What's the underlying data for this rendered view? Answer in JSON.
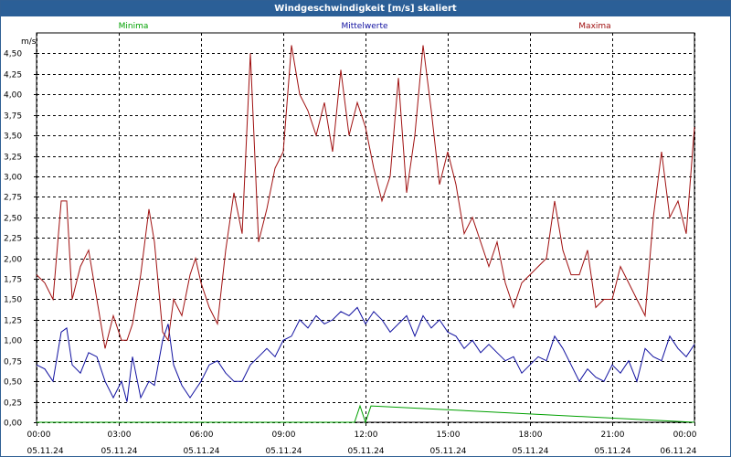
{
  "window": {
    "title": "Windgeschwindigkeit [m/s] skaliert"
  },
  "chart_data": {
    "type": "line",
    "unit_label": "m/s",
    "ylim": [
      0,
      4.75
    ],
    "yticks": [
      0,
      0.25,
      0.5,
      0.75,
      1.0,
      1.25,
      1.5,
      1.75,
      2.0,
      2.25,
      2.5,
      2.75,
      3.0,
      3.25,
      3.5,
      3.75,
      4.0,
      4.25,
      4.5
    ],
    "ytick_labels": [
      "0,00",
      "0,25",
      "0,50",
      "0,75",
      "1,00",
      "1,25",
      "1,50",
      "1,75",
      "2,00",
      "2,25",
      "2,50",
      "2,75",
      "3,00",
      "3,25",
      "3,50",
      "3,75",
      "4,00",
      "4,25",
      "4,50"
    ],
    "xlim": [
      0,
      24
    ],
    "xticks": [
      0,
      3,
      6,
      9,
      12,
      15,
      18,
      21,
      24
    ],
    "xtick_times": [
      "00:00",
      "03:00",
      "06:00",
      "09:00",
      "12:00",
      "15:00",
      "18:00",
      "21:00",
      "00:00"
    ],
    "xtick_dates": [
      "05.11.24",
      "05.11.24",
      "05.11.24",
      "05.11.24",
      "05.11.24",
      "05.11.24",
      "05.11.24",
      "05.11.24",
      "06.11.24"
    ],
    "grid": true,
    "series": [
      {
        "name": "Minima",
        "color": "#00a000",
        "x": [
          0,
          11.6,
          11.8,
          12.0,
          12.2,
          24
        ],
        "y": [
          0,
          0,
          0.2,
          0,
          0.2,
          0
        ]
      },
      {
        "name": "Mittelwerte",
        "color": "#1010a0",
        "x": [
          0,
          0.3,
          0.6,
          0.9,
          1.1,
          1.3,
          1.6,
          1.9,
          2.2,
          2.5,
          2.8,
          3.1,
          3.3,
          3.5,
          3.8,
          4.1,
          4.3,
          4.6,
          4.8,
          5.0,
          5.3,
          5.6,
          5.8,
          6.0,
          6.3,
          6.6,
          6.9,
          7.2,
          7.5,
          7.8,
          8.1,
          8.4,
          8.7,
          9.0,
          9.3,
          9.6,
          9.9,
          10.2,
          10.5,
          10.8,
          11.1,
          11.4,
          11.7,
          12.0,
          12.3,
          12.6,
          12.9,
          13.2,
          13.5,
          13.8,
          14.1,
          14.4,
          14.7,
          15.0,
          15.3,
          15.6,
          15.9,
          16.2,
          16.5,
          16.8,
          17.1,
          17.4,
          17.7,
          18.0,
          18.3,
          18.6,
          18.9,
          19.2,
          19.5,
          19.8,
          20.1,
          20.4,
          20.7,
          21.0,
          21.3,
          21.6,
          21.9,
          22.2,
          22.5,
          22.8,
          23.1,
          23.4,
          23.7,
          24.0
        ],
        "y": [
          0.7,
          0.65,
          0.5,
          1.1,
          1.15,
          0.7,
          0.6,
          0.85,
          0.8,
          0.5,
          0.3,
          0.5,
          0.25,
          0.8,
          0.3,
          0.5,
          0.45,
          1.0,
          1.2,
          0.7,
          0.45,
          0.3,
          0.4,
          0.5,
          0.7,
          0.75,
          0.6,
          0.5,
          0.5,
          0.7,
          0.8,
          0.9,
          0.8,
          1.0,
          1.05,
          1.25,
          1.15,
          1.3,
          1.2,
          1.25,
          1.35,
          1.3,
          1.4,
          1.2,
          1.35,
          1.25,
          1.1,
          1.2,
          1.3,
          1.05,
          1.3,
          1.15,
          1.25,
          1.1,
          1.05,
          0.9,
          1.0,
          0.85,
          0.95,
          0.85,
          0.75,
          0.8,
          0.6,
          0.7,
          0.8,
          0.75,
          1.05,
          0.9,
          0.7,
          0.5,
          0.65,
          0.55,
          0.5,
          0.7,
          0.6,
          0.75,
          0.5,
          0.9,
          0.8,
          0.75,
          1.05,
          0.9,
          0.8,
          0.95
        ]
      },
      {
        "name": "Maxima",
        "color": "#a01010",
        "x": [
          0,
          0.3,
          0.6,
          0.9,
          1.1,
          1.3,
          1.6,
          1.9,
          2.2,
          2.5,
          2.8,
          3.1,
          3.3,
          3.5,
          3.8,
          4.1,
          4.3,
          4.6,
          4.8,
          5.0,
          5.3,
          5.6,
          5.8,
          6.0,
          6.3,
          6.6,
          6.9,
          7.2,
          7.5,
          7.8,
          8.1,
          8.4,
          8.7,
          9.0,
          9.3,
          9.6,
          9.9,
          10.2,
          10.5,
          10.8,
          11.1,
          11.4,
          11.7,
          12.0,
          12.3,
          12.6,
          12.9,
          13.2,
          13.5,
          13.8,
          14.1,
          14.4,
          14.7,
          15.0,
          15.3,
          15.6,
          15.9,
          16.2,
          16.5,
          16.8,
          17.1,
          17.4,
          17.7,
          18.0,
          18.3,
          18.6,
          18.9,
          19.2,
          19.5,
          19.8,
          20.1,
          20.4,
          20.7,
          21.0,
          21.3,
          21.6,
          21.9,
          22.2,
          22.5,
          22.8,
          23.1,
          23.4,
          23.7,
          24.0
        ],
        "y": [
          1.8,
          1.7,
          1.5,
          2.7,
          2.7,
          1.5,
          1.9,
          2.1,
          1.5,
          0.9,
          1.3,
          1.0,
          1.0,
          1.2,
          1.8,
          2.6,
          2.2,
          1.1,
          1.0,
          1.5,
          1.3,
          1.8,
          2.0,
          1.7,
          1.4,
          1.2,
          2.1,
          2.8,
          2.3,
          4.5,
          2.2,
          2.6,
          3.1,
          3.3,
          4.6,
          4.0,
          3.8,
          3.5,
          3.9,
          3.3,
          4.3,
          3.5,
          3.9,
          3.6,
          3.1,
          2.7,
          3.0,
          4.2,
          2.8,
          3.5,
          4.6,
          3.8,
          2.9,
          3.3,
          2.9,
          2.3,
          2.5,
          2.2,
          1.9,
          2.2,
          1.7,
          1.4,
          1.7,
          1.8,
          1.9,
          2.0,
          2.7,
          2.1,
          1.8,
          1.8,
          2.1,
          1.4,
          1.5,
          1.5,
          1.9,
          1.7,
          1.5,
          1.3,
          2.5,
          3.3,
          2.5,
          2.7,
          2.3,
          3.6
        ]
      }
    ]
  }
}
